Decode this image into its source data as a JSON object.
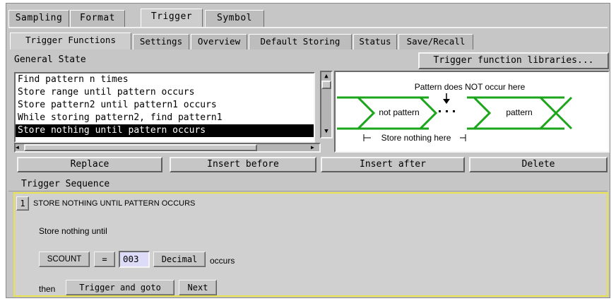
{
  "tabs": [
    "Sampling",
    "Format",
    "Trigger",
    "Symbol"
  ],
  "subtabs": [
    "Trigger Functions",
    "Settings",
    "Overview",
    "Default Storing",
    "Status",
    "Save/Recall"
  ],
  "general_state_label": "General State",
  "libraries_button": "Trigger function libraries...",
  "functions": [
    "Find pattern n times",
    "Store range until pattern occurs",
    "Store pattern2 until pattern1 occurs",
    "While storing pattern2, find pattern1",
    "Store nothing until pattern occurs"
  ],
  "diagram": {
    "top_label": "Pattern does NOT occur here",
    "left_label": "not pattern",
    "right_label": "pattern",
    "bottom_label": "Store nothing here",
    "line_color": "#1aa51a"
  },
  "actions": [
    "Replace",
    "Insert before",
    "Insert after",
    "Delete"
  ],
  "trigger_sequence_label": "Trigger Sequence",
  "sequence": {
    "number": "1",
    "title": "STORE NOTHING UNTIL PATTERN OCCURS",
    "line1": "Store nothing until",
    "scount": "SCOUNT",
    "equals": "=",
    "count": "003",
    "base": "Decimal",
    "occurs": "occurs",
    "then": "then",
    "trigger_goto": "Trigger and goto",
    "next": "Next"
  },
  "colors": {
    "panel": "#c6c6c6",
    "selection": "#000000",
    "highlight_border": "#e9e24f",
    "value_field": "#dcdcf8"
  }
}
